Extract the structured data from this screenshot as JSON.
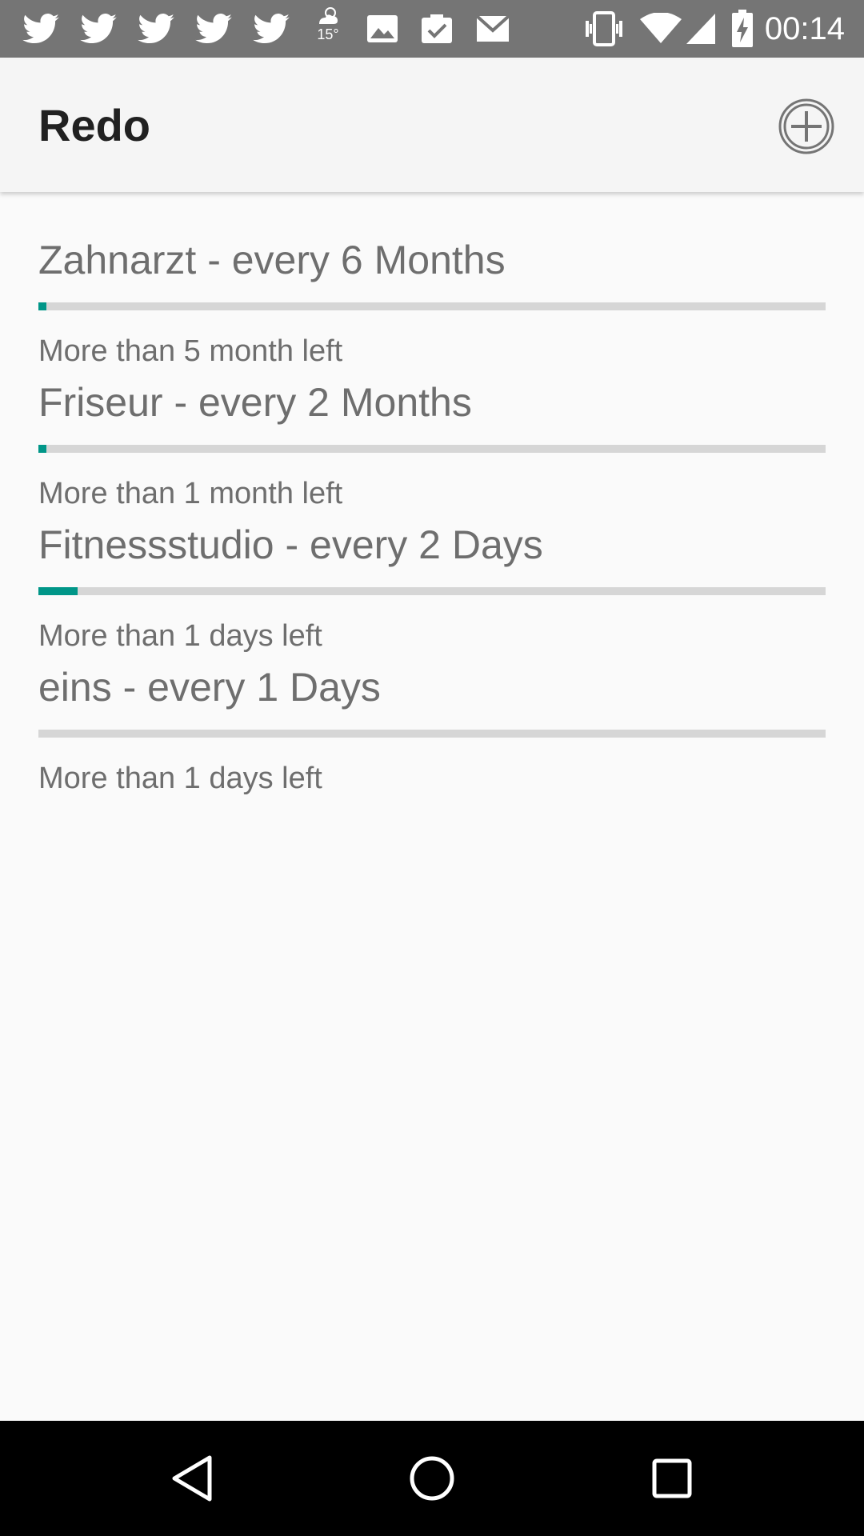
{
  "status_bar": {
    "time": "00:14",
    "weather_temp": "15°",
    "icons": [
      "twitter-icon",
      "twitter-icon",
      "twitter-icon",
      "twitter-icon",
      "twitter-icon",
      "weather-icon",
      "image-icon",
      "clipboard-check-icon",
      "gmail-icon",
      "vibrate-icon",
      "wifi-icon",
      "signal-icon",
      "battery-charging-icon"
    ]
  },
  "app_bar": {
    "title": "Redo",
    "add_icon": "add-circle-icon"
  },
  "tasks": [
    {
      "title": "Zahnarzt - every 6 Months",
      "status": "More than 5 month left",
      "progress": 0.01
    },
    {
      "title": "Friseur - every 2 Months",
      "status": "More than 1 month left",
      "progress": 0.01
    },
    {
      "title": "Fitnessstudio - every 2 Days",
      "status": "More than 1 days left",
      "progress": 0.05
    },
    {
      "title": "eins - every 1 Days",
      "status": "More than 1 days left",
      "progress": 0.0
    }
  ],
  "colors": {
    "status_bar": "#757575",
    "app_bar": "#f5f5f5",
    "accent": "#009688",
    "track": "#d6d6d6",
    "text": "#6e6e6e",
    "title": "#212121"
  },
  "nav_bar": {
    "icons": [
      "back-icon",
      "home-icon",
      "recents-icon"
    ]
  }
}
